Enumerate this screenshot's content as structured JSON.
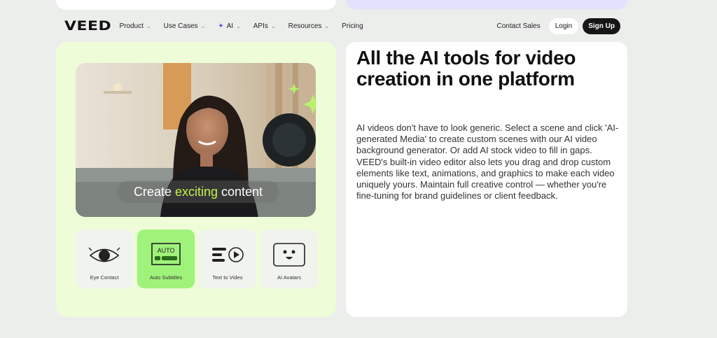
{
  "nav": {
    "logo": "VEED",
    "items": [
      {
        "label": "Product",
        "chevron": true
      },
      {
        "label": "Use Cases",
        "chevron": true
      },
      {
        "label": "AI",
        "chevron": true
      },
      {
        "label": "APIs",
        "chevron": true
      },
      {
        "label": "Resources",
        "chevron": true
      },
      {
        "label": "Pricing",
        "chevron": false
      }
    ],
    "contact_sales": "Contact Sales",
    "login": "Login",
    "sign_up": "Sign Up"
  },
  "hero": {
    "caption_before": "Create",
    "caption_highlight": "exciting",
    "caption_after": "content",
    "highlight_color": "#c3f24b",
    "tools": [
      {
        "label": "Eye Contact",
        "icon": "eye-icon",
        "active": false
      },
      {
        "label": "Auto Subtitles",
        "icon": "auto-subtitles-icon",
        "badge": "AUTO",
        "active": true
      },
      {
        "label": "Text to Video",
        "icon": "text-to-video-icon",
        "active": false
      },
      {
        "label": "AI Avatars",
        "icon": "avatar-face-icon",
        "active": false
      }
    ]
  },
  "content": {
    "headline": "All the AI tools for video creation in one platform",
    "body": "AI videos don't have to look generic. Select a scene and click 'AI-generated Media' to create custom scenes with our AI video background generator. Or add AI stock video to fill in gaps. VEED's built-in video editor also lets you drag and drop custom elements like text, animations, and graphics to make each video uniquely yours. Maintain full creative control — whether you're fine-tuning for brand guidelines or client feedback."
  },
  "colors": {
    "left_panel_bg": "#eefcd8",
    "active_tool_bg": "#9ff27a",
    "ai_sparkle": "#5b4cf0"
  }
}
